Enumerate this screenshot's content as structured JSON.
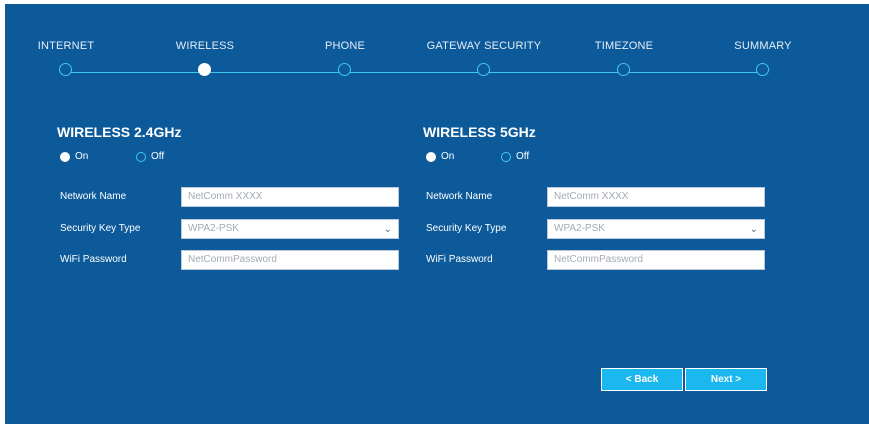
{
  "steps": [
    {
      "label": "INTERNET",
      "active": false
    },
    {
      "label": "WIRELESS",
      "active": true
    },
    {
      "label": "PHONE",
      "active": false
    },
    {
      "label": "GATEWAY SECURITY",
      "active": false
    },
    {
      "label": "TIMEZONE",
      "active": false
    },
    {
      "label": "SUMMARY",
      "active": false
    }
  ],
  "wireless24": {
    "title": "WIRELESS 2.4GHz",
    "on_label": "On",
    "off_label": "Off",
    "selected": "On",
    "network_name_label": "Network Name",
    "network_name_placeholder": "NetComm XXXX",
    "security_key_label": "Security Key Type",
    "security_key_value": "WPA2-PSK",
    "password_label": "WiFi Password",
    "password_placeholder": "NetCommPassword"
  },
  "wireless5": {
    "title": "WIRELESS 5GHz",
    "on_label": "On",
    "off_label": "Off",
    "selected": "On",
    "network_name_label": "Network Name",
    "network_name_placeholder": "NetComm XXXX",
    "security_key_label": "Security Key Type",
    "security_key_value": "WPA2-PSK",
    "password_label": "WiFi Password",
    "password_placeholder": "NetCommPassword"
  },
  "buttons": {
    "back_label": "< Back",
    "next_label": "Next >"
  },
  "colors": {
    "background": "#0d5a9b",
    "accent": "#3fc8ee",
    "button": "#1ab8ef"
  },
  "icons": {
    "dropdown": "chevron-down-icon"
  }
}
